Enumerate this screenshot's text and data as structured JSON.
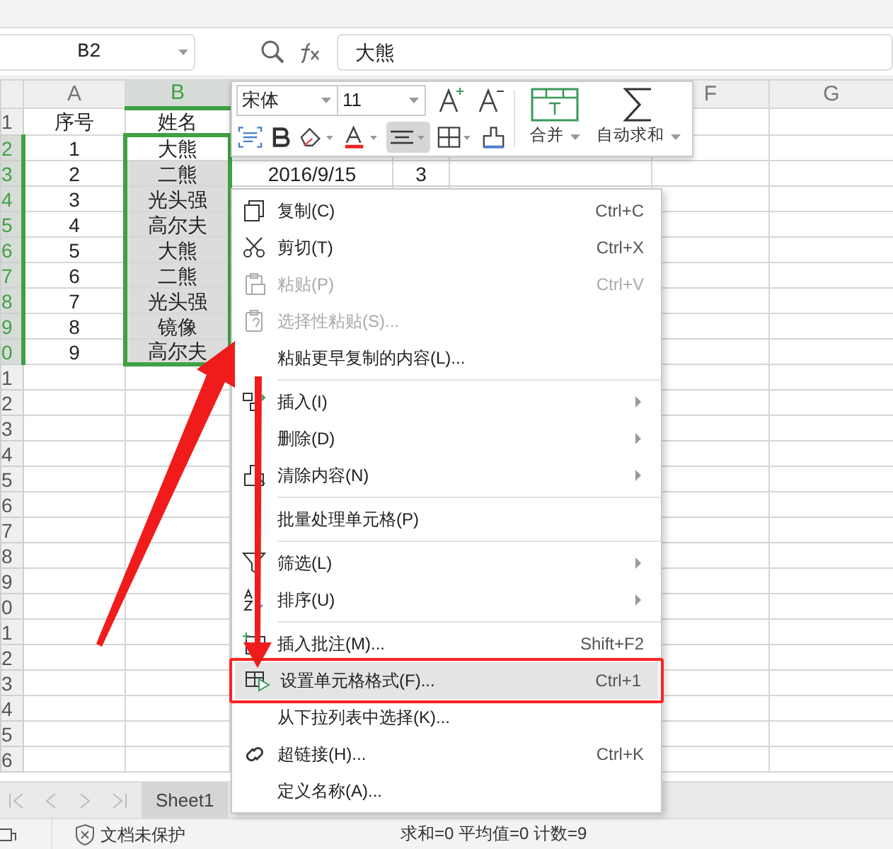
{
  "formula_bar": {
    "cell_ref": "B2",
    "formula": "大熊"
  },
  "columns": [
    {
      "label": "A",
      "selected": false
    },
    {
      "label": "B",
      "selected": true
    },
    {},
    {},
    {},
    {
      "label": "F",
      "selected": false
    },
    {
      "label": "G",
      "selected": false
    }
  ],
  "rows": [
    {
      "header": "1",
      "selected": false,
      "cells": [
        {
          "text": "序号",
          "selected": false
        },
        {
          "text": "姓名",
          "selected": false
        }
      ]
    },
    {
      "header": "2",
      "selected": true,
      "cells": [
        {
          "text": "1",
          "selected": false
        },
        {
          "text": "大熊",
          "selected": true,
          "active": true
        }
      ]
    },
    {
      "header": "3",
      "selected": true,
      "cells": [
        {
          "text": "2",
          "selected": false
        },
        {
          "text": "二熊",
          "selected": true,
          "active": false
        },
        {
          "text": "2016/9/15",
          "selected": false
        },
        {
          "text": "3",
          "selected": false
        }
      ]
    },
    {
      "header": "4",
      "selected": true,
      "cells": [
        {
          "text": "3",
          "selected": false
        },
        {
          "text": "光头强",
          "selected": true,
          "active": false
        }
      ]
    },
    {
      "header": "5",
      "selected": true,
      "cells": [
        {
          "text": "4",
          "selected": false
        },
        {
          "text": "高尔夫",
          "selected": true,
          "active": false
        }
      ]
    },
    {
      "header": "6",
      "selected": true,
      "cells": [
        {
          "text": "5",
          "selected": false
        },
        {
          "text": "大熊",
          "selected": true,
          "active": false
        }
      ]
    },
    {
      "header": "7",
      "selected": true,
      "cells": [
        {
          "text": "6",
          "selected": false
        },
        {
          "text": "二熊",
          "selected": true,
          "active": false
        }
      ]
    },
    {
      "header": "8",
      "selected": true,
      "cells": [
        {
          "text": "7",
          "selected": false
        },
        {
          "text": "光头强",
          "selected": true,
          "active": false
        }
      ]
    },
    {
      "header": "9",
      "selected": true,
      "cells": [
        {
          "text": "8",
          "selected": false
        },
        {
          "text": "镜像",
          "selected": true,
          "active": false
        }
      ]
    },
    {
      "header": "0",
      "selected": true,
      "cells": [
        {
          "text": "9",
          "selected": false
        },
        {
          "text": "高尔夫",
          "selected": true,
          "active": false
        }
      ]
    },
    {
      "header": "1",
      "selected": false,
      "cells": []
    },
    {
      "header": "2",
      "selected": false,
      "cells": []
    },
    {
      "header": "3",
      "selected": false,
      "cells": []
    },
    {
      "header": "4",
      "selected": false,
      "cells": []
    },
    {
      "header": "5",
      "selected": false,
      "cells": []
    },
    {
      "header": "6",
      "selected": false,
      "cells": []
    },
    {
      "header": "7",
      "selected": false,
      "cells": []
    },
    {
      "header": "8",
      "selected": false,
      "cells": []
    },
    {
      "header": "9",
      "selected": false,
      "cells": []
    },
    {
      "header": "0",
      "selected": false,
      "cells": []
    },
    {
      "header": "1",
      "selected": false,
      "cells": []
    },
    {
      "header": "2",
      "selected": false,
      "cells": []
    },
    {
      "header": "3",
      "selected": false,
      "cells": []
    },
    {
      "header": "4",
      "selected": false,
      "cells": []
    },
    {
      "header": "5",
      "selected": false,
      "cells": []
    },
    {
      "header": "6",
      "selected": false,
      "cells": []
    }
  ],
  "mini_toolbar": {
    "font": "宋体",
    "size": "11",
    "align_pressed": true,
    "merge_label": "合并",
    "sum_label": "自动求和"
  },
  "context_menu": {
    "groups": [
      [
        {
          "label": "复制(C)",
          "shortcut": "Ctrl+C",
          "disabled": false,
          "submenu": false,
          "selected": false
        },
        {
          "label": "剪切(T)",
          "shortcut": "Ctrl+X",
          "disabled": false,
          "submenu": false,
          "selected": false
        },
        {
          "label": "粘贴(P)",
          "shortcut": "Ctrl+V",
          "disabled": true,
          "submenu": false,
          "selected": false
        },
        {
          "label": "选择性粘贴(S)...",
          "disabled": true,
          "submenu": false,
          "selected": false
        },
        {
          "label": "粘贴更早复制的内容(L)...",
          "disabled": false,
          "submenu": false,
          "selected": false
        }
      ],
      [
        {
          "label": "插入(I)",
          "disabled": false,
          "submenu": true,
          "selected": false
        },
        {
          "label": "删除(D)",
          "disabled": false,
          "submenu": true,
          "selected": false
        },
        {
          "label": "清除内容(N)",
          "disabled": false,
          "submenu": true,
          "selected": false
        }
      ],
      [
        {
          "label": "批量处理单元格(P)",
          "disabled": false,
          "submenu": false,
          "selected": false
        }
      ],
      [
        {
          "label": "筛选(L)",
          "disabled": false,
          "submenu": true,
          "selected": false
        },
        {
          "label": "排序(U)",
          "disabled": false,
          "submenu": true,
          "selected": false
        }
      ],
      [
        {
          "label": "插入批注(M)...",
          "shortcut": "Shift+F2",
          "disabled": false,
          "submenu": false,
          "selected": false
        },
        {
          "label": "设置单元格格式(F)...",
          "shortcut": "Ctrl+1",
          "disabled": false,
          "submenu": false,
          "selected": true
        },
        {
          "label": "从下拉列表中选择(K)...",
          "disabled": false,
          "submenu": false,
          "selected": false
        },
        {
          "label": "超链接(H)...",
          "shortcut": "Ctrl+K",
          "disabled": false,
          "submenu": false,
          "selected": false
        },
        {
          "label": "定义名称(A)...",
          "disabled": false,
          "submenu": false,
          "selected": false
        }
      ]
    ]
  },
  "sheet_tabs": [
    {
      "label": "Sheet1",
      "selected": true
    }
  ],
  "status_bar": {
    "protection": "文档未保护",
    "summary": "求和=0  平均值=0  计数=9"
  }
}
